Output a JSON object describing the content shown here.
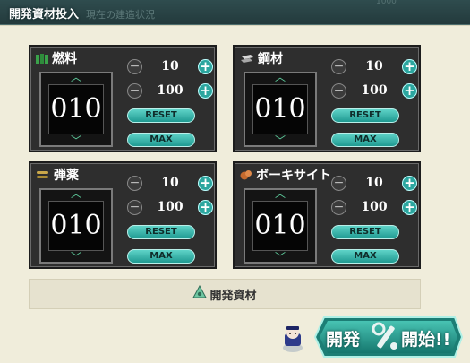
{
  "header": {
    "title": "開発資材投入",
    "ghost_text": "現在の建造状況",
    "ghost_number": "1000"
  },
  "resources": [
    {
      "name": "燃料",
      "icon": "fuel-icon",
      "value": "010",
      "step_small": "10",
      "step_large": "100",
      "reset_label": "RESET",
      "max_label": "MAX"
    },
    {
      "name": "鋼材",
      "icon": "steel-icon",
      "value": "010",
      "step_small": "10",
      "step_large": "100",
      "reset_label": "RESET",
      "max_label": "MAX"
    },
    {
      "name": "弾薬",
      "icon": "ammo-icon",
      "value": "010",
      "step_small": "10",
      "step_large": "100",
      "reset_label": "RESET",
      "max_label": "MAX"
    },
    {
      "name": "ボーキサイト",
      "icon": "bauxite-icon",
      "value": "010",
      "step_small": "10",
      "step_large": "100",
      "reset_label": "RESET",
      "max_label": "MAX"
    }
  ],
  "dev_material": {
    "label": "開発資材",
    "icon": "dev-material-icon"
  },
  "start_button": {
    "label_left": "開発",
    "label_right": "開始!!",
    "icon": "wrench-icon"
  },
  "colors": {
    "accent": "#2ca69f",
    "panel": "#2e2e2e",
    "board": "#f0eddb",
    "counter_arrow": "#5fd09f"
  }
}
